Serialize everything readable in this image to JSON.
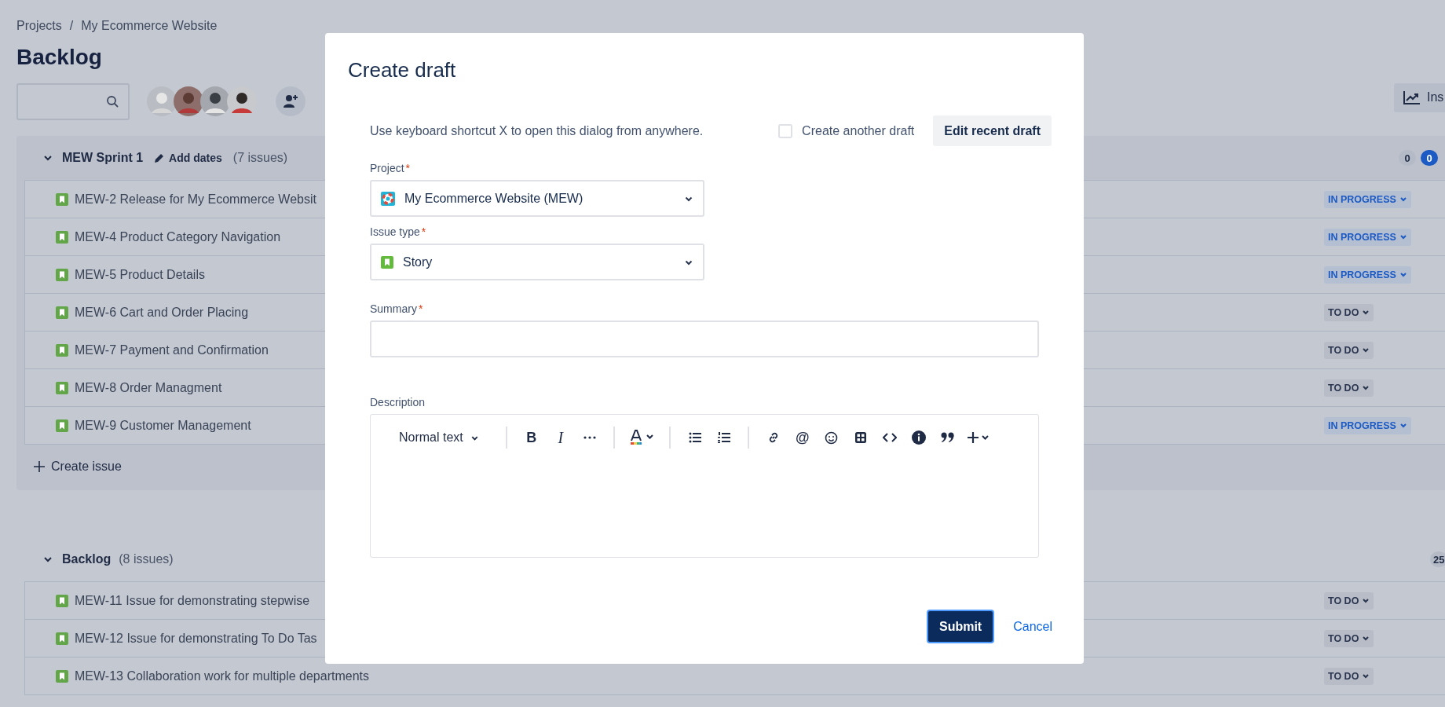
{
  "breadcrumbs": [
    "Projects",
    "My Ecommerce Website"
  ],
  "breadcrumb_separator": "/",
  "title": "Backlog",
  "toolbar": {
    "insights_button": "Ins"
  },
  "sprint": {
    "name": "MEW Sprint 1",
    "expanded": true,
    "add_dates": "Add dates",
    "count": "(7 issues)",
    "counts": [
      {
        "value": "0",
        "kind": "todo"
      },
      {
        "value": "0",
        "kind": "in_progress"
      }
    ],
    "issues": [
      {
        "key": "MEW-2",
        "summary": "Release for My Ecommerce Websit",
        "status": "IN PROGRESS",
        "kind": "in_progress"
      },
      {
        "key": "MEW-4",
        "summary": "Product Category Navigation",
        "status": "IN PROGRESS",
        "kind": "in_progress"
      },
      {
        "key": "MEW-5",
        "summary": "Product Details",
        "status": "IN PROGRESS",
        "kind": "in_progress"
      },
      {
        "key": "MEW-6",
        "summary": "Cart and Order Placing",
        "status": "TO DO",
        "kind": "todo"
      },
      {
        "key": "MEW-7",
        "summary": "Payment and Confirmation",
        "status": "TO DO",
        "kind": "todo"
      },
      {
        "key": "MEW-8",
        "summary": "Order Managment",
        "status": "TO DO",
        "kind": "todo"
      },
      {
        "key": "MEW-9",
        "summary": "Customer Management",
        "status": "IN PROGRESS",
        "kind": "in_progress"
      }
    ],
    "create_issue": "Create issue"
  },
  "backlog": {
    "name": "Backlog",
    "expanded": true,
    "count": "(8 issues)",
    "counts": [
      {
        "value": "25",
        "kind": "todo"
      }
    ],
    "issues": [
      {
        "key": "MEW-11",
        "summary": "Issue for demonstrating stepwise",
        "status": "TO DO",
        "kind": "todo"
      },
      {
        "key": "MEW-12",
        "summary": "Issue for demonstrating To Do Tas",
        "status": "TO DO",
        "kind": "todo"
      },
      {
        "key": "MEW-13",
        "summary": "Collaboration work for multiple departments",
        "status": "TO DO",
        "kind": "todo"
      }
    ]
  },
  "dialog": {
    "title": "Create draft",
    "hint": "Use keyboard shortcut X to open this dialog from anywhere.",
    "create_another": {
      "label": "Create another draft",
      "checked": false
    },
    "edit_recent": "Edit recent draft",
    "project": {
      "label": "Project",
      "required_mark": "*",
      "value": "My Ecommerce Website (MEW)"
    },
    "issue_type": {
      "label": "Issue type",
      "required_mark": "*",
      "value": "Story"
    },
    "summary": {
      "label": "Summary",
      "required_mark": "*"
    },
    "description": {
      "label": "Description",
      "toolbar": [
        {
          "kind": "style",
          "label": "Normal text"
        },
        {
          "kind": "sep"
        },
        {
          "kind": "bold",
          "label": "B"
        },
        {
          "kind": "italic",
          "label": "I"
        },
        {
          "kind": "more"
        },
        {
          "kind": "sep"
        },
        {
          "kind": "color"
        },
        {
          "kind": "sep"
        },
        {
          "kind": "bullets"
        },
        {
          "kind": "numbers"
        },
        {
          "kind": "sep"
        },
        {
          "kind": "link"
        },
        {
          "kind": "mention",
          "label": "@"
        },
        {
          "kind": "emoji"
        },
        {
          "kind": "table"
        },
        {
          "kind": "code"
        },
        {
          "kind": "info"
        },
        {
          "kind": "quote"
        },
        {
          "kind": "insert"
        }
      ]
    },
    "submit": "Submit",
    "cancel": "Cancel"
  }
}
